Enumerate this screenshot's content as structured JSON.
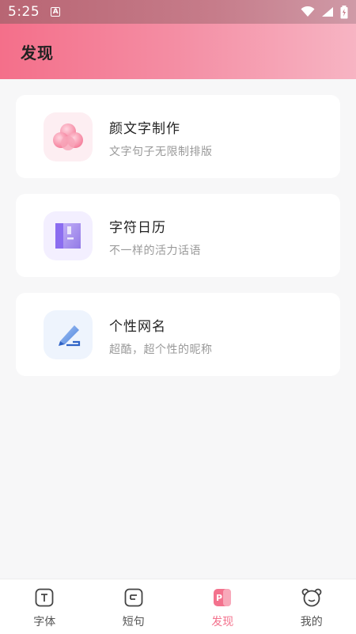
{
  "status_bar": {
    "time": "5:25",
    "badge": "A"
  },
  "header": {
    "title": "发现"
  },
  "cards": [
    {
      "title": "颜文字制作",
      "subtitle": "文字句子无限制排版",
      "icon": "flower-cloud-icon"
    },
    {
      "title": "字符日历",
      "subtitle": "不一样的活力话语",
      "icon": "calendar-book-icon"
    },
    {
      "title": "个性网名",
      "subtitle": "超酷，超个性的昵称",
      "icon": "pen-sign-icon"
    }
  ],
  "nav": [
    {
      "label": "字体",
      "icon": "font-icon",
      "active": false
    },
    {
      "label": "短句",
      "icon": "sentence-icon",
      "active": false
    },
    {
      "label": "发现",
      "icon": "discover-icon",
      "active": true
    },
    {
      "label": "我的",
      "icon": "bear-profile-icon",
      "active": false
    }
  ],
  "colors": {
    "accent": "#f3728d",
    "header_start": "#f46f8a",
    "header_end": "#f7b4c3"
  }
}
